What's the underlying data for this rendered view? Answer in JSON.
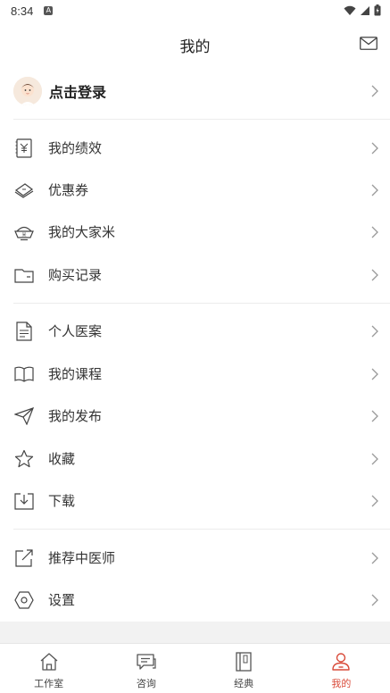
{
  "status": {
    "time": "8:34",
    "notif_icon": "a-badge-icon"
  },
  "header": {
    "title": "我的",
    "mail_icon": "mail-icon"
  },
  "login": {
    "label": "点击登录"
  },
  "menu_group_1": [
    {
      "label": "我的绩效",
      "icon": "yuan-receipt-icon"
    },
    {
      "label": "优惠券",
      "icon": "coupon-icon"
    },
    {
      "label": "我的大家米",
      "icon": "rice-bowl-icon"
    },
    {
      "label": "购买记录",
      "icon": "wallet-icon"
    }
  ],
  "menu_group_2": [
    {
      "label": "个人医案",
      "icon": "document-icon"
    },
    {
      "label": "我的课程",
      "icon": "book-icon"
    },
    {
      "label": "我的发布",
      "icon": "paper-plane-icon"
    },
    {
      "label": "收藏",
      "icon": "star-icon"
    },
    {
      "label": "下载",
      "icon": "download-icon"
    }
  ],
  "menu_group_3": [
    {
      "label": "推荐中医师",
      "icon": "share-icon"
    },
    {
      "label": "设置",
      "icon": "hexagon-gear-icon"
    }
  ],
  "tabs": [
    {
      "label": "工作室",
      "icon": "house-icon",
      "active": false
    },
    {
      "label": "咨询",
      "icon": "chat-icon",
      "active": false
    },
    {
      "label": "经典",
      "icon": "classic-book-icon",
      "active": false
    },
    {
      "label": "我的",
      "icon": "person-icon",
      "active": true
    }
  ],
  "colors": {
    "accent": "#d94b3a",
    "text": "#333333",
    "divider": "#ececec"
  }
}
